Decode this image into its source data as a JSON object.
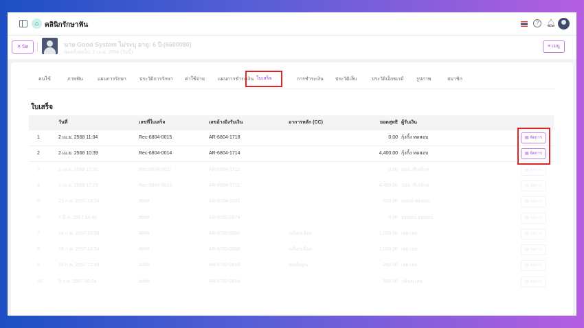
{
  "header": {
    "clinic_name": "คลินิกรักษาฟัน"
  },
  "patient": {
    "close_label": "✕ ปิด",
    "name": "นาย Good System  ไม่ระบุ  อายุ: 6 ปี (6600080)",
    "sub": "นัดครั้งต่อไป: 2 เม.ย. 2568 (วันนี้)",
    "menu_label": "≡ เมนู"
  },
  "tabs": [
    "คนไข้",
    "ภาพฟัน",
    "แผนการรักษา",
    "ประวัติการรักษา",
    "ค่าใช้จ่าย",
    "แผนการชำระเงิน",
    "ใบเสร็จ",
    "การชำระเงิน",
    "ประวัติเล็บ",
    "ประวัติเอ็กซเรย์",
    "รูปภาพ",
    "สมาชิก"
  ],
  "section_title": "ใบเสร็จ",
  "table": {
    "columns": [
      "",
      "วันที่",
      "เลขที่ใบเสร็จ",
      "เลขอ้างอิงรับเงิน",
      "อาการหลัก (CC)",
      "ยอดสุทธิ",
      "ผู้รับเงิน"
    ],
    "manage_label": "จัดการ",
    "rows": [
      [
        "1",
        "2 เม.ย. 2568 11:04",
        "Rec-6804-0015",
        "AR-6804-1718",
        "",
        "0.00",
        "กุ้งกิ้ง ทดสอบ"
      ],
      [
        "2",
        "2 เม.ย. 2568 10:39",
        "Rec-6804-0014",
        "AR-6804-1714",
        "",
        "4,400.00",
        "กุ้งกิ้ง ทดสอบ"
      ],
      [
        "3",
        "1 เม.ย. 2568 17:31",
        "Rec-6804-0011",
        "AR-6804-1712",
        "",
        "0.00",
        "ปอย. ทีเจลิกุล"
      ],
      [
        "4",
        "1 เม.ย. 2568 17:29",
        "Rec-6804-0010",
        "AR-6804-1711",
        "",
        "4,400.00",
        "ปอย. ทีเจลิกุล"
      ],
      [
        "5",
        "23 ก.ค. 2567 14:54",
        "####",
        "AR-6704-1007",
        "",
        "500.00",
        "แพทย์ ทดสอบ"
      ],
      [
        "6",
        "7 มี.ค. 2567 14:48",
        "####",
        "AR-6702-0874",
        "",
        "0.00",
        "ทดสอบ ทดสอบ"
      ],
      [
        "7",
        "19 ก.พ. 2567 15:58",
        "####",
        "AR-6702-0860",
        "เหงือกเลือด",
        "1,000.00",
        "เลย เลย"
      ],
      [
        "8",
        "19 ก.พ. 2567 15:54",
        "####",
        "AR-6702-0856",
        "เหงือกเลือด",
        "1,000.00",
        "เลย เลย"
      ],
      [
        "9",
        "19 ก.พ. 2567 15:49",
        "####",
        "AR-6702-0815",
        "ฟุดพันปูน",
        "250.00",
        "เลย เลย"
      ],
      [
        "10",
        "9 ก.พ. 2567 16:04",
        "####",
        "AR-6702-0814",
        "",
        "550.00",
        "วทันชุ เลย."
      ]
    ]
  }
}
